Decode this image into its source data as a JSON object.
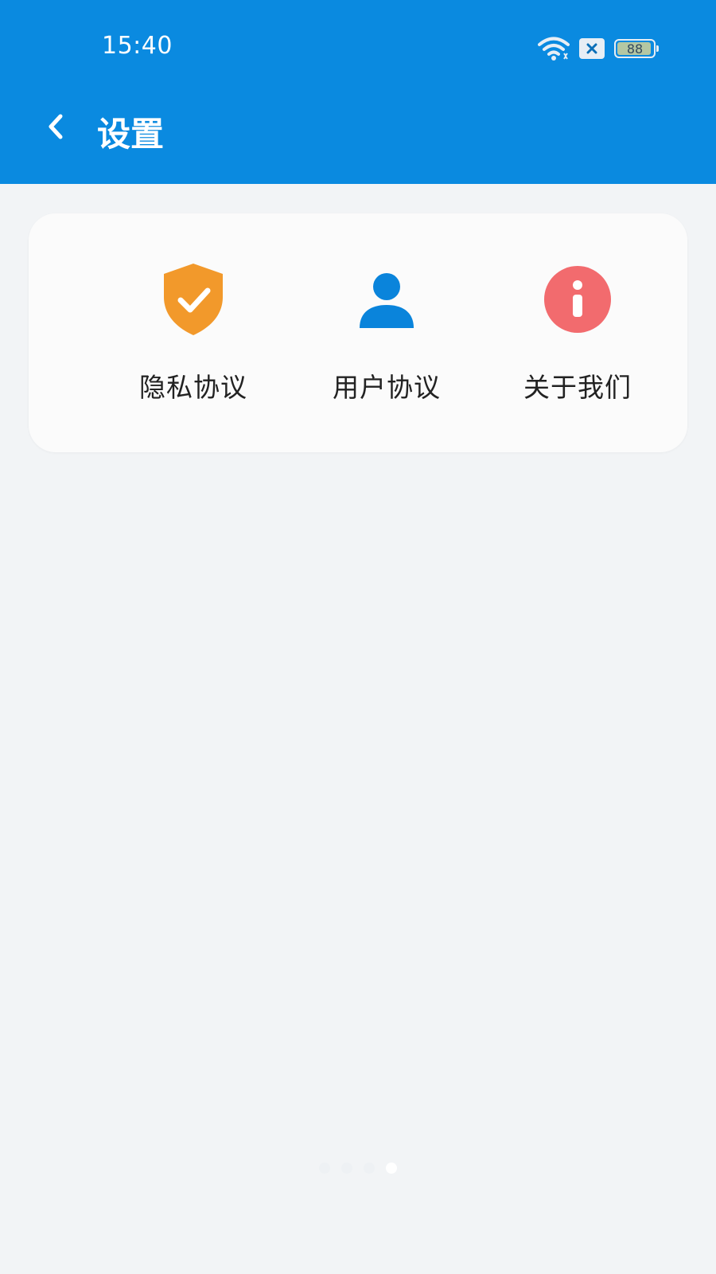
{
  "status_bar": {
    "time": "15:40",
    "battery": "88",
    "icons": [
      "wifi-icon",
      "sim-no-signal-icon",
      "battery-icon"
    ]
  },
  "header": {
    "title": "设置",
    "back_icon": "chevron-left-icon",
    "background_color": "#0a8ae0"
  },
  "menu": {
    "items": [
      {
        "label": "隐私协议",
        "icon": "shield-check-icon",
        "color": "#f2992b"
      },
      {
        "label": "用户协议",
        "icon": "user-icon",
        "color": "#0a84db"
      },
      {
        "label": "关于我们",
        "icon": "info-icon",
        "color": "#f26b6e"
      }
    ]
  },
  "pager": {
    "count": 4,
    "active_index": 3
  }
}
